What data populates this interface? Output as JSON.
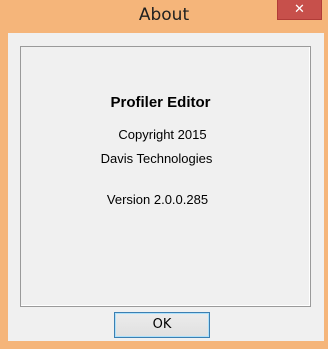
{
  "dialog": {
    "title": "About",
    "close_glyph": "✕",
    "product_name": "Profiler Editor",
    "copyright": "Copyright 2015",
    "company": "Davis Technologies",
    "version": "Version  2.0.0.285",
    "ok_label": "OK"
  },
  "colors": {
    "frame": "#f5b57a",
    "close_button": "#c7504b",
    "client": "#f0f0f0"
  }
}
